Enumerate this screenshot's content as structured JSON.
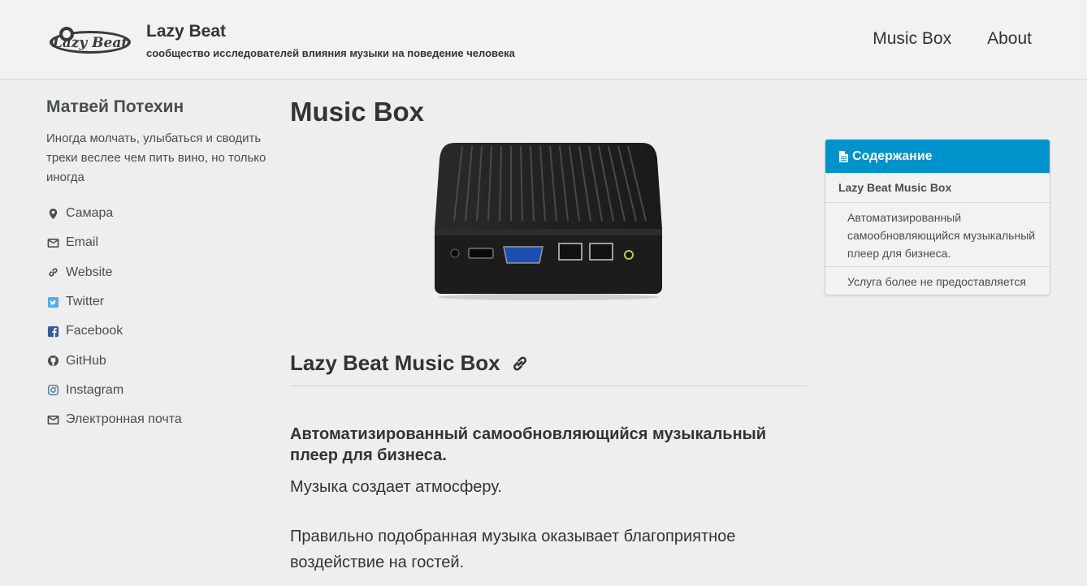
{
  "site": {
    "logo_text": "Lazy Beat",
    "title": "Lazy Beat",
    "subtitle": "сообщество исследователей влияния музыки на поведение человека"
  },
  "nav": {
    "items": [
      "Music Box",
      "About"
    ]
  },
  "author": {
    "name": "Матвей Потехин",
    "bio": "Иногда молчать, улыбаться и сводить треки веслее чем пить вино, но только иногда",
    "links": [
      {
        "icon": "location-icon",
        "label": "Самара"
      },
      {
        "icon": "email-icon",
        "label": "Email"
      },
      {
        "icon": "link-icon",
        "label": "Website"
      },
      {
        "icon": "twitter-icon",
        "label": "Twitter"
      },
      {
        "icon": "facebook-icon",
        "label": "Facebook"
      },
      {
        "icon": "github-icon",
        "label": "GitHub"
      },
      {
        "icon": "instagram-icon",
        "label": "Instagram"
      },
      {
        "icon": "email-icon",
        "label": "Электронная почта"
      }
    ]
  },
  "content": {
    "title": "Music Box",
    "section_title": "Lazy Beat Music Box",
    "subheading": "Автоматизированный самообновляющийся музыкальный плеер для бизнеса.",
    "paragraphs": [
      "Музыка создает атмосферу.",
      "Правильно подобранная музыка оказывает благоприятное воздействие на гостей."
    ]
  },
  "toc": {
    "heading": "Содержание",
    "items": [
      {
        "label": "Lazy Beat Music Box",
        "level": 1
      },
      {
        "label": "Автоматизированный самообновляющийся музыкальный плеер для бизнеса.",
        "level": 2
      },
      {
        "label": "Услуга более не предоставляется",
        "level": 2
      }
    ]
  },
  "colors": {
    "accent": "#0092ca",
    "text": "#313436",
    "background": "#eeeeee",
    "twitter": "#55acee",
    "facebook": "#3b5998",
    "instagram": "#517fa4"
  }
}
